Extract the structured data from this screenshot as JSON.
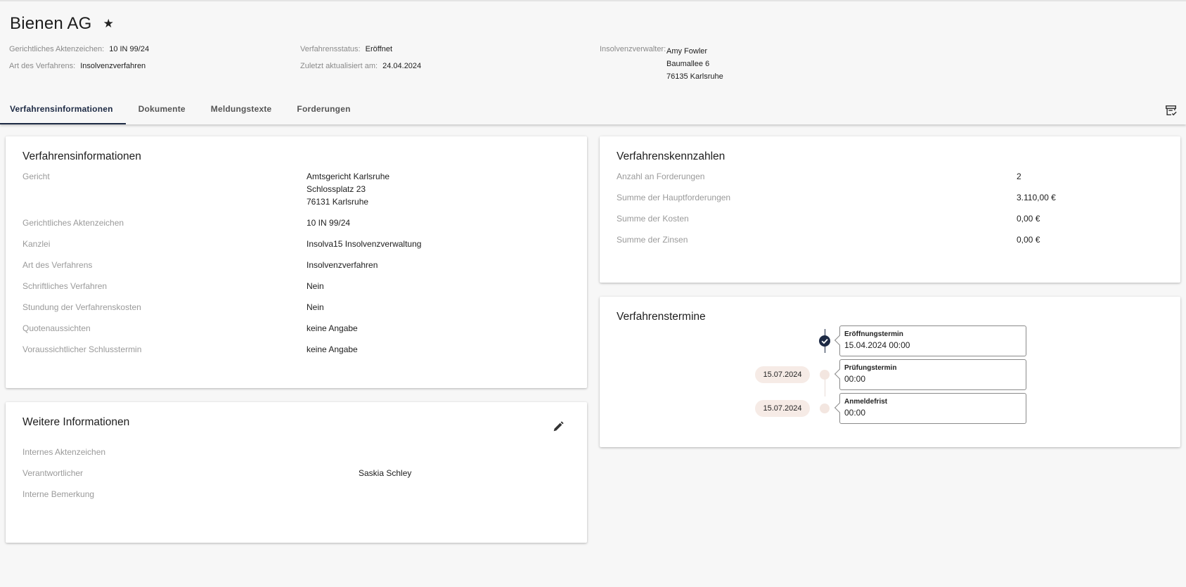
{
  "header": {
    "title": "Bienen AG",
    "meta": {
      "aktenzeichen_label": "Gerichtliches Aktenzeichen:",
      "aktenzeichen_value": "10 IN 99/24",
      "art_label": "Art des Verfahrens:",
      "art_value": "Insolvenzverfahren",
      "status_label": "Verfahrensstatus:",
      "status_value": "Eröffnet",
      "updated_label": "Zuletzt aktualisiert am:",
      "updated_value": "24.04.2024",
      "verwalter_label": "Insolvenzverwalter:",
      "verwalter_name": "Amy Fowler",
      "verwalter_street": "Baumallee 6",
      "verwalter_city": "76135 Karlsruhe"
    }
  },
  "tabs": [
    {
      "label": "Verfahrensinformationen"
    },
    {
      "label": "Dokumente"
    },
    {
      "label": "Meldungstexte"
    },
    {
      "label": "Forderungen"
    }
  ],
  "info_card": {
    "title": "Verfahrensinformationen",
    "rows": [
      {
        "label": "Gericht",
        "value": [
          "Amtsgericht Karlsruhe",
          "Schlossplatz 23",
          "76131 Karlsruhe"
        ]
      },
      {
        "label": "Gerichtliches Aktenzeichen",
        "value": "10 IN 99/24"
      },
      {
        "label": "Kanzlei",
        "value": "Insolva15 Insolvenzverwaltung"
      },
      {
        "label": "Art des Verfahrens",
        "value": "Insolvenzverfahren"
      },
      {
        "label": "Schriftliches Verfahren",
        "value": "Nein"
      },
      {
        "label": "Stundung der Verfahrenskosten",
        "value": "Nein"
      },
      {
        "label": "Quotenaussichten",
        "value": "keine Angabe"
      },
      {
        "label": "Voraussichtlicher Schlusstermin",
        "value": "keine Angabe"
      }
    ]
  },
  "weitere_card": {
    "title": "Weitere Informationen",
    "rows": [
      {
        "label": "Internes Aktenzeichen",
        "value": ""
      },
      {
        "label": "Verantwortlicher",
        "value": "Saskia Schley"
      },
      {
        "label": "Interne Bemerkung",
        "value": ""
      }
    ]
  },
  "kennzahlen_card": {
    "title": "Verfahrenskennzahlen",
    "rows": [
      {
        "label": "Anzahl an Forderungen",
        "value": "2"
      },
      {
        "label": "Summe der Hauptforderungen",
        "value": "3.110,00 €"
      },
      {
        "label": "Summe der Kosten",
        "value": "0,00 €"
      },
      {
        "label": "Summe der Zinsen",
        "value": "0,00 €"
      }
    ]
  },
  "termine_card": {
    "title": "Verfahrenstermine",
    "events": [
      {
        "date": "",
        "label": "Eröffnungstermin",
        "value": "15.04.2024 00:00",
        "done": true
      },
      {
        "date": "15.07.2024",
        "label": "Prüfungstermin",
        "value": "00:00",
        "done": false
      },
      {
        "date": "15.07.2024",
        "label": "Anmeldefrist",
        "value": "00:00",
        "done": false
      }
    ]
  },
  "colors": {
    "accent": "#1d2a44",
    "date_pill": "#f6ebe6",
    "label_grey": "#9a9a9a"
  },
  "icons": {
    "favorite": "star-icon",
    "archive": "archive-check-icon",
    "edit": "pencil-icon",
    "done": "check-circle-icon"
  }
}
